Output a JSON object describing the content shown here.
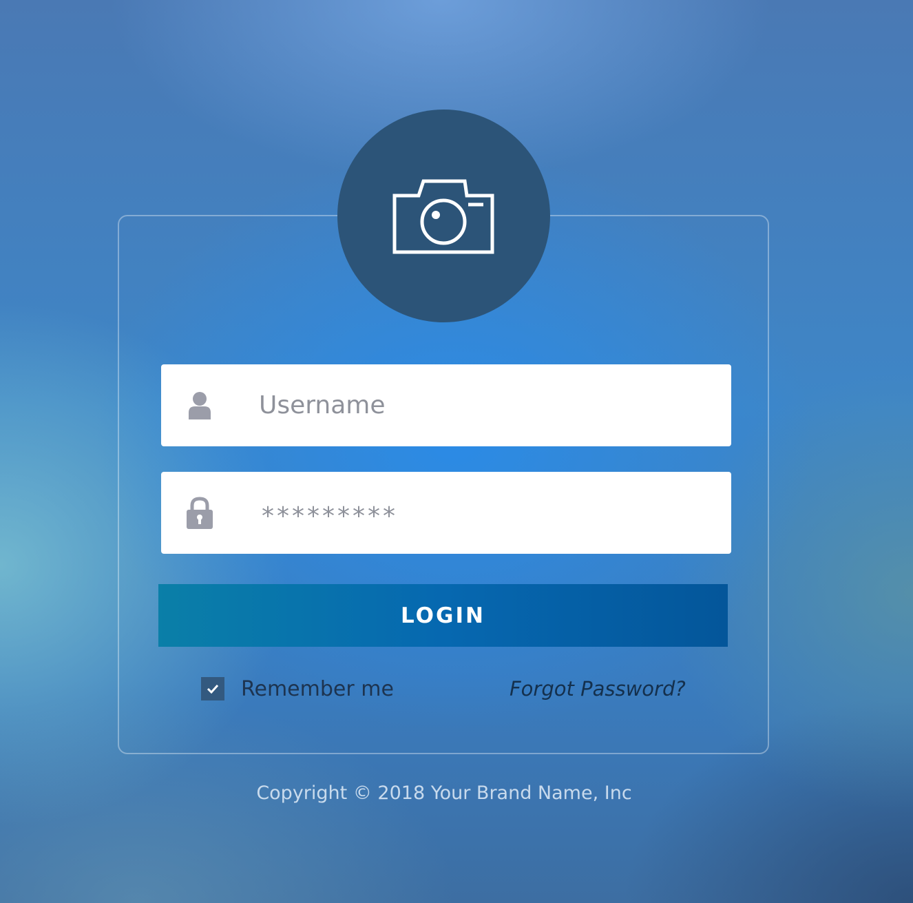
{
  "login_form": {
    "username": {
      "placeholder": "Username",
      "icon": "user-icon"
    },
    "password": {
      "masked_value": "*********",
      "icon": "lock-icon"
    },
    "login_button_label": "LOGIN",
    "remember_me": {
      "label": "Remember me",
      "checked": true
    },
    "forgot_password_label": "Forgot Password?"
  },
  "avatar_icon": "camera-icon",
  "footer": {
    "copyright": "Copyright © 2018 Your Brand Name, Inc"
  },
  "colors": {
    "avatar_bg": "#2c5478",
    "button_gradient_start": "#0a7fa8",
    "button_gradient_end": "#04569a",
    "checkbox_bg": "#33597f",
    "field_bg": "#ffffff",
    "placeholder_text": "#8e919a"
  }
}
